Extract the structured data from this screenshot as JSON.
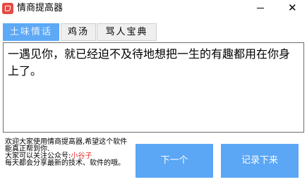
{
  "window": {
    "title": "情商提高器",
    "minimize_label": "—",
    "close_label": "✕"
  },
  "tabs": [
    {
      "label": "土味情话",
      "active": true
    },
    {
      "label": "鸡汤",
      "active": false
    },
    {
      "label": "骂人宝典",
      "active": false
    }
  ],
  "content": {
    "text": "一遇见你，就已经迫不及待地想把一生的有趣都用在你身上了。"
  },
  "footer": {
    "line1": "欢迎大家使用情商提高器,希望这个软件能真正帮到你.",
    "line2_prefix": "大家可以关注公众号:",
    "account_name": "小谷子",
    "line3": "每天都会分享最新的技术、软件的哦。"
  },
  "buttons": {
    "next_label": "下一个",
    "save_label": "记录下来"
  },
  "colors": {
    "accent_blue": "#5ba6f5",
    "app_icon_red": "#e54a44",
    "account_red": "#e52f2f"
  }
}
